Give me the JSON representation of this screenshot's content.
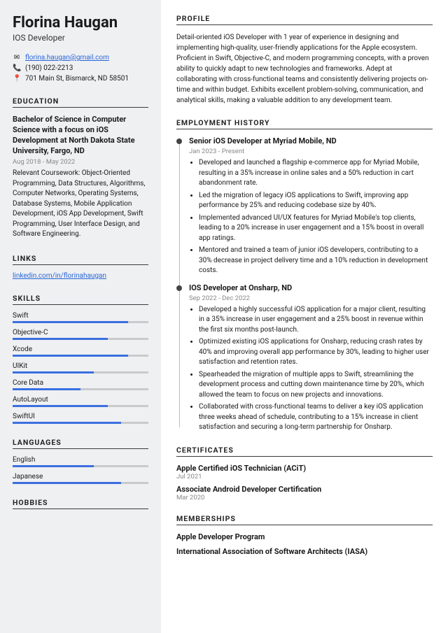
{
  "name": "Florina Haugan",
  "role": "IOS Developer",
  "contact": {
    "email": "florina.haugan@gmail.com",
    "phone": "(190) 022-2213",
    "address": "701 Main St, Bismarck, ND 58501"
  },
  "headings": {
    "education": "Education",
    "links": "Links",
    "skills": "Skills",
    "languages": "Languages",
    "hobbies": "Hobbies",
    "profile": "Profile",
    "employment": "Employment History",
    "certificates": "Certificates",
    "memberships": "Memberships"
  },
  "education": {
    "title": "Bachelor of Science in Computer Science with a focus on iOS Development at North Dakota State University, Fargo, ND",
    "dates": "Aug 2018 - May 2022",
    "body": "Relevant Coursework: Object-Oriented Programming, Data Structures, Algorithms, Computer Networks, Operating Systems, Database Systems, Mobile Application Development, iOS App Development, Swift Programming, User Interface Design, and Software Engineering."
  },
  "links": {
    "linkedin": "linkedin.com/in/florinahaugan"
  },
  "skills": [
    {
      "name": "Swift",
      "pct": 85
    },
    {
      "name": "Objective-C",
      "pct": 70
    },
    {
      "name": "Xcode",
      "pct": 85
    },
    {
      "name": "UIKit",
      "pct": 60
    },
    {
      "name": "Core Data",
      "pct": 50
    },
    {
      "name": "AutoLayout",
      "pct": 70
    },
    {
      "name": "SwiftUI",
      "pct": 80
    }
  ],
  "languages": [
    {
      "name": "English",
      "pct": 60
    },
    {
      "name": "Japanese",
      "pct": 80
    }
  ],
  "profile": "Detail-oriented iOS Developer with 1 year of experience in designing and implementing high-quality, user-friendly applications for the Apple ecosystem. Proficient in Swift, Objective-C, and modern programming concepts, with a proven ability to quickly adapt to new technologies and frameworks. Adept at collaborating with cross-functional teams and consistently delivering projects on-time and within budget. Exhibits excellent problem-solving, communication, and analytical skills, making a valuable addition to any development team.",
  "jobs": [
    {
      "title": "Senior iOS Developer at Myriad Mobile, ND",
      "dates": "Jan 2023 - Present",
      "bullets": [
        "Developed and launched a flagship e-commerce app for Myriad Mobile, resulting in a 35% increase in online sales and a 50% reduction in cart abandonment rate.",
        "Led the migration of legacy iOS applications to Swift, improving app performance by 25% and reducing codebase size by 40%.",
        "Implemented advanced UI/UX features for Myriad Mobile's top clients, leading to a 20% increase in user engagement and a 15% boost in overall app ratings.",
        "Mentored and trained a team of junior iOS developers, contributing to a 30% decrease in project delivery time and a 10% reduction in development costs."
      ]
    },
    {
      "title": "IOS Developer at Onsharp, ND",
      "dates": "Sep 2022 - Dec 2022",
      "bullets": [
        "Developed a highly successful iOS application for a major client, resulting in a 35% increase in user engagement and a 25% boost in revenue within the first six months post-launch.",
        "Optimized existing iOS applications for Onsharp, reducing crash rates by 40% and improving overall app performance by 30%, leading to higher user satisfaction and retention rates.",
        "Spearheaded the migration of multiple apps to Swift, streamlining the development process and cutting down maintenance time by 20%, which allowed the team to focus on new projects and innovations.",
        "Collaborated with cross-functional teams to deliver a key iOS application three weeks ahead of schedule, contributing to a 15% increase in client satisfaction and securing a long-term partnership for Onsharp."
      ]
    }
  ],
  "certificates": [
    {
      "title": "Apple Certified iOS Technician (ACiT)",
      "date": "Jul 2021"
    },
    {
      "title": "Associate Android Developer Certification",
      "date": "Mar 2020"
    }
  ],
  "memberships": [
    "Apple Developer Program",
    "International Association of Software Architects (IASA)"
  ]
}
